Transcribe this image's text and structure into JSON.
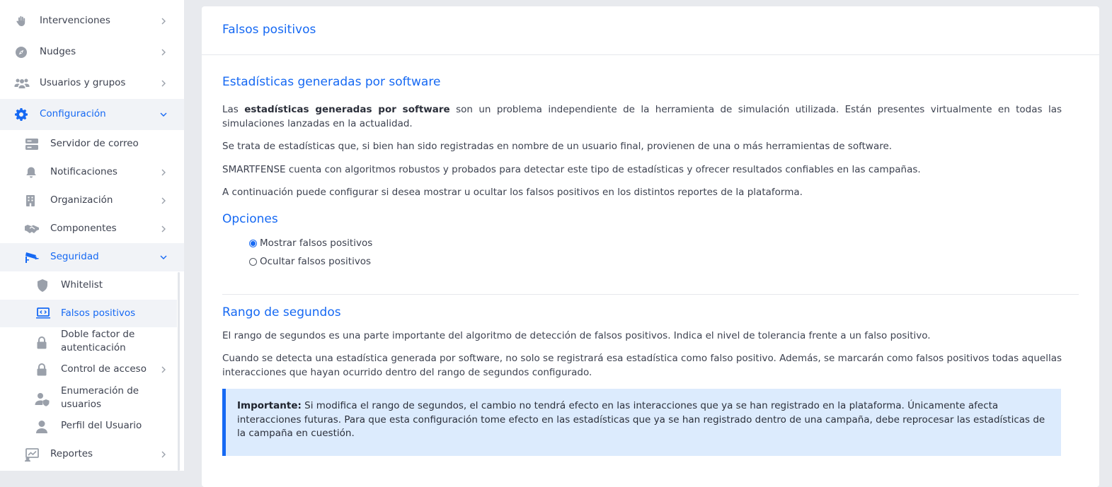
{
  "sidebar": {
    "intervenciones": "Intervenciones",
    "nudges": "Nudges",
    "usuarios_grupos": "Usuarios y grupos",
    "configuracion": "Configuración",
    "servidor_correo": "Servidor de correo",
    "notificaciones": "Notificaciones",
    "organizacion": "Organización",
    "componentes": "Componentes",
    "seguridad": "Seguridad",
    "whitelist": "Whitelist",
    "falsos_positivos": "Falsos positivos",
    "doble_factor": "Doble factor de autenticación",
    "control_acceso": "Control de acceso",
    "enumeracion": "Enumeración de usuarios",
    "perfil_usuario": "Perfil del Usuario",
    "reportes": "Reportes"
  },
  "page": {
    "title": "Falsos positivos",
    "section1": {
      "title": "Estadísticas generadas por software",
      "p1_prefix": "Las ",
      "p1_bold": "estadísticas generadas por software",
      "p1_rest": " son un problema independiente de la herramienta de simulación utilizada. Están presentes virtualmente en todas las simulaciones lanzadas en la actualidad.",
      "p2": "Se trata de estadísticas que, si bien han sido registradas en nombre de un usuario final, provienen de una o más herramientas de software.",
      "p3": "SMARTFENSE cuenta con algoritmos robustos y probados para detectar este tipo de estadísticas y ofrecer resultados confiables en las campañas.",
      "p4": "A continuación puede configurar si desea mostrar u ocultar los falsos positivos en los distintos reportes de la plataforma."
    },
    "options": {
      "title": "Opciones",
      "show_label": "Mostrar falsos positivos",
      "hide_label": "Ocultar falsos positivos",
      "selected": "show"
    },
    "section2": {
      "title": "Rango de segundos",
      "p1": "El rango de segundos es una parte importante del algoritmo de detección de falsos positivos. Indica el nivel de tolerancia frente a un falso positivo.",
      "p2": "Cuando se detecta una estadística generada por software, no solo se registrará esa estadística como falso positivo. Además, se marcarán como falsos positivos todas aquellas interacciones que hayan ocurrido dentro del rango de segundos configurado."
    },
    "callout": {
      "bold": "Importante:",
      "text": " Si modifica el rango de segundos, el cambio no tendrá efecto en las interacciones que ya se han registrado en la plataforma. Únicamente afecta interacciones futuras. Para que esta configuración tome efecto en las estadísticas que ya se han registrado dentro de una campaña, debe reprocesar las estadísticas de la campaña en cuestión."
    }
  },
  "colors": {
    "accent": "#1669f3",
    "callout_bg": "#dcebfd",
    "active_bg": "#f1f3f7"
  }
}
